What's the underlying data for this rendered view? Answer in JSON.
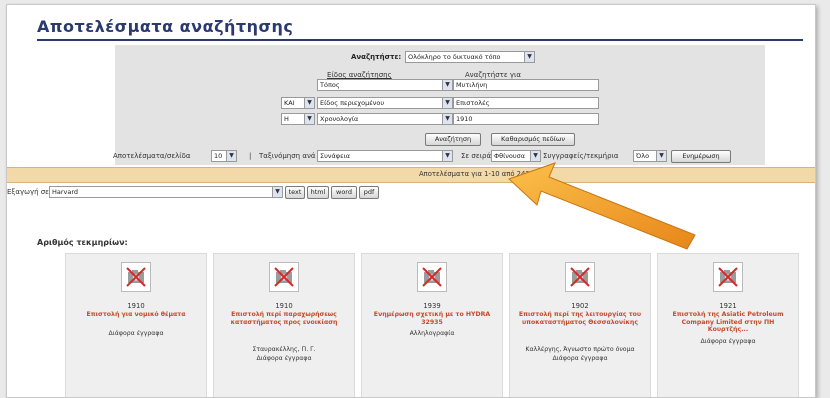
{
  "page_title": "Αποτελέσματα αναζήτησης",
  "search_form": {
    "search_in_label": "Αναζητήστε:",
    "search_in_value": "Ολόκληρο το δικτυακό τόπο",
    "search_type_label": "Είδος αναζήτησης",
    "search_for_label": "Αναζητήστε για",
    "rows": [
      {
        "operator": "",
        "field": "Τόπος",
        "value": "Μυτιλήνη"
      },
      {
        "operator": "ΚΑΙ",
        "field": "Είδος περιεχομένου",
        "value": "Επιστολές"
      },
      {
        "operator": "Η",
        "field": "Χρονολογία",
        "value": "1910"
      }
    ],
    "search_button": "Αναζήτηση",
    "clear_button": "Καθαρισμός πεδίων",
    "per_page_label": "Αποτελέσματα/σελίδα",
    "per_page_value": "10",
    "separator": "|",
    "sort_label": "Ταξινόμηση ανά",
    "sort_value": "Συνάφεια",
    "order_label": "Σε σειρά",
    "order_value": "Φθίνουσα",
    "creators_label": "Συγγραφείς/τεκμήρια",
    "creators_value": "Όλο",
    "update_button": "Ενημέρωση"
  },
  "results_summary": "Αποτελέσματα για 1-10 από 243",
  "export": {
    "label": "Εξαγωγή σε:",
    "format_value": "Harvard",
    "buttons": [
      "text",
      "html",
      "word",
      "pdf"
    ]
  },
  "section_heading": "Αριθμός τεκμηρίων:",
  "results": [
    {
      "year": "1910",
      "title": "Επιστολή για νομικό θέματα",
      "lines": [
        "Διάφορα έγγραφα"
      ]
    },
    {
      "year": "1910",
      "title": "Επιστολή περί παραχωρήσεως καταστήματος προς ενοικίαση",
      "lines": [
        "Σταυρακέλλης, Π. Γ.",
        "Διάφορα έγγραφα"
      ]
    },
    {
      "year": "1939",
      "title": "Ενημέρωση σχετική με το HYDRA 32935",
      "lines": [
        "Αλληλογραφία"
      ]
    },
    {
      "year": "1902",
      "title": "Επιστολή περί της λειτουργίας του υποκαταστήματος Θεσσαλονίκης",
      "lines": [
        "Καλλέργης, Άγνωστο πρώτο όνομα",
        "Διάφορα έγγραφα"
      ]
    },
    {
      "year": "1921",
      "title": "Επιστολή της Asiatic Petroleum Company Limited στην ΠΗ Κουρτζής...",
      "lines": [
        "Διάφορα έγγραφα"
      ]
    }
  ],
  "colors": {
    "title": "#2a3a6e",
    "results_bar": "#f3d8a8",
    "card_title": "#c54a2a",
    "arrow": "#f29a1f"
  }
}
